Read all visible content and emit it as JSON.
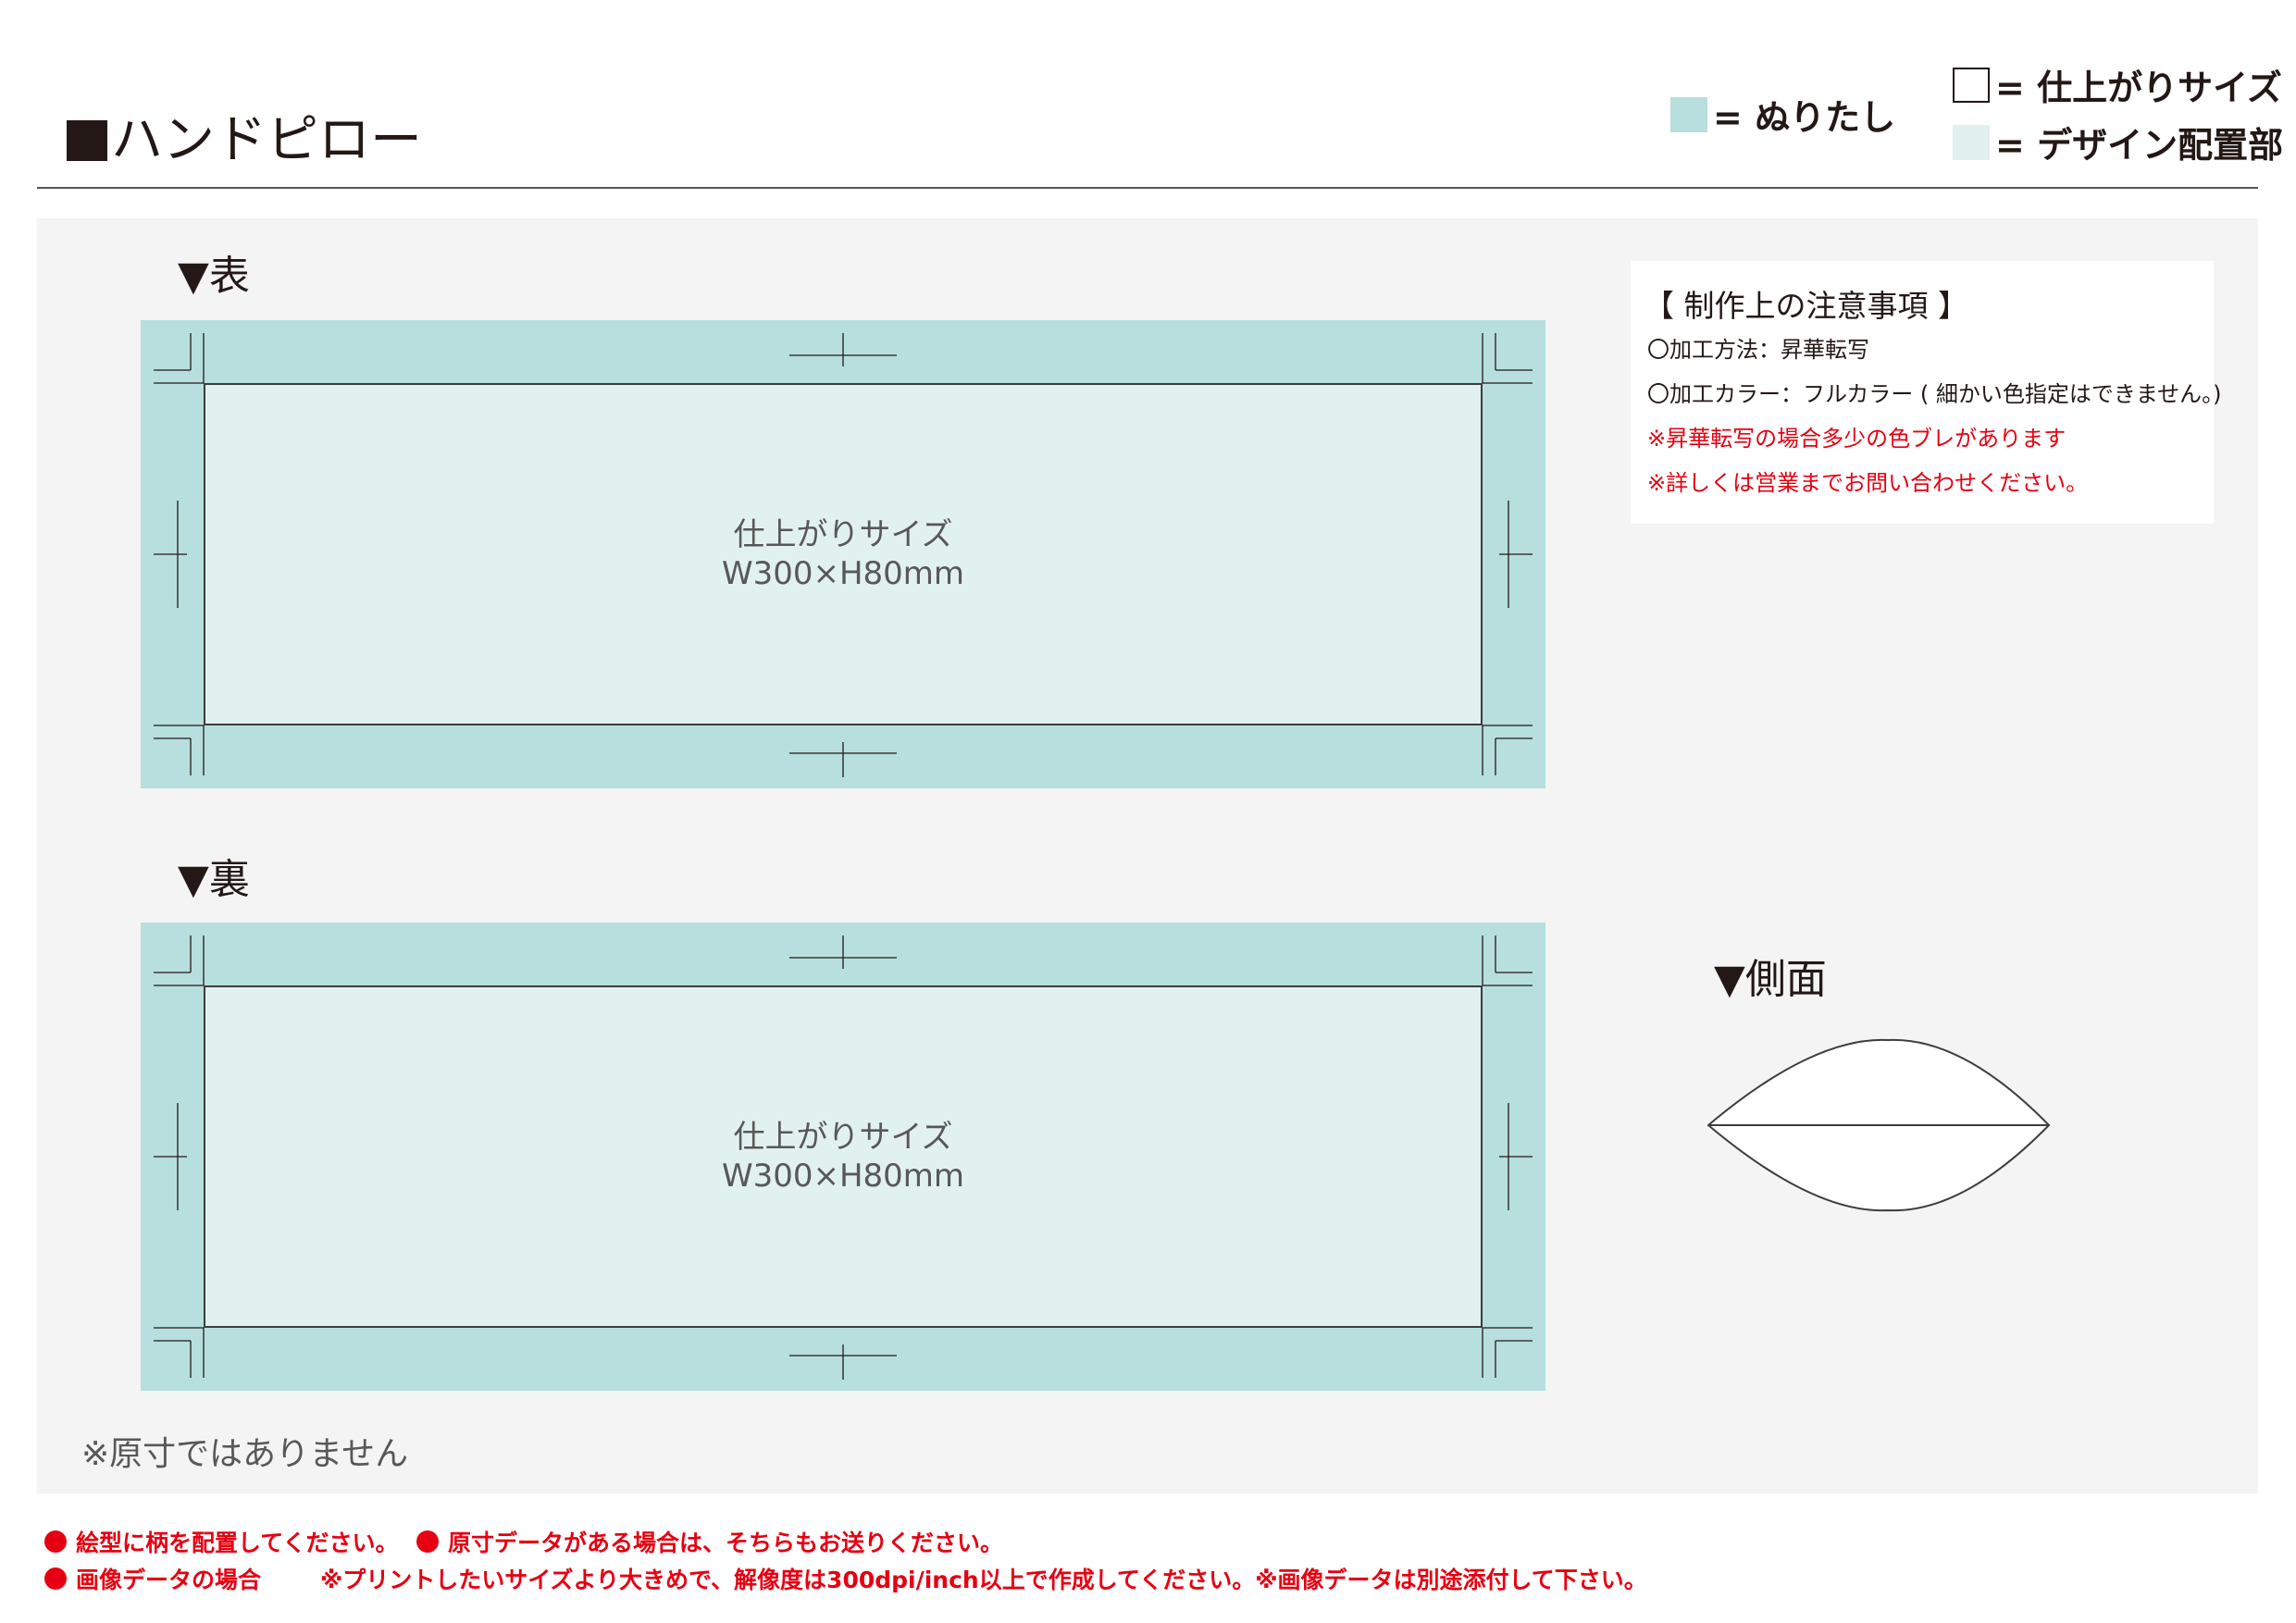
{
  "title": "ハンドピロー",
  "legend": {
    "bleed": "= ぬりたし",
    "finish": "= 仕上がりサイズ",
    "design": "= デザイン配置部"
  },
  "front": {
    "label": "▼表",
    "finish_label": "仕上がりサイズ",
    "size": "W300×H80mm"
  },
  "back": {
    "label": "▼裏",
    "finish_label": "仕上がりサイズ",
    "size": "W300×H80mm"
  },
  "side": {
    "label": "▼側面"
  },
  "notes": {
    "title": "【 制作上の注意事項 】",
    "method": "〇加工方法：昇華転写",
    "color": "〇加工カラー：フルカラー ( 細かい色指定はできません。)",
    "warn1": "※昇華転写の場合多少の色ブレがあります",
    "warn2": "※詳しくは営業までお問い合わせください。"
  },
  "disclaimer": "※原寸ではありません",
  "footer": {
    "item1": "絵型に柄を配置してください。",
    "item2": "原寸データがある場合は、そちらもお送りください。",
    "item3": "画像データの場合",
    "item3_detail": "※プリントしたいサイズより大きめで、解像度は300dpi/inch以上で作成してください。※画像データは別途添付して下さい。"
  },
  "colors": {
    "bleed": "#b6dfdd",
    "design": "#e1f1f0",
    "warning": "#e60012"
  }
}
